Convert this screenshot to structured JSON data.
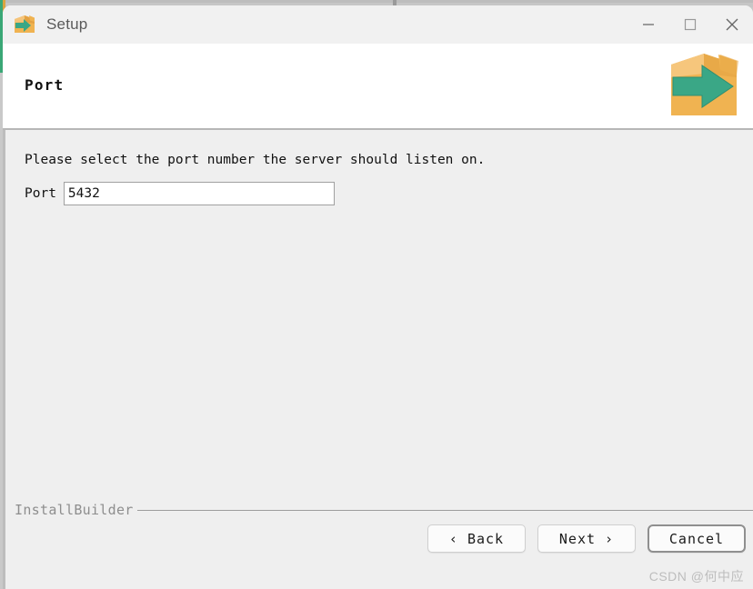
{
  "window": {
    "title": "Setup",
    "icon": "installer-box-arrow-icon",
    "controls": {
      "minimize": "minimize-icon",
      "maximize": "maximize-icon",
      "close": "close-icon"
    }
  },
  "header": {
    "title": "Port",
    "logo": "installer-box-arrow-logo"
  },
  "main": {
    "instruction": "Please select the port number the server should listen on.",
    "field": {
      "label": "Port",
      "value": "5432",
      "placeholder": ""
    }
  },
  "footer": {
    "brand": "InstallBuilder",
    "buttons": {
      "back": "‹ Back",
      "next": "Next ›",
      "cancel": "Cancel"
    }
  },
  "watermark": "CSDN @何中应",
  "colors": {
    "titlebar_bg": "#f1f1f1",
    "header_bg": "#ffffff",
    "body_bg": "#efefef",
    "box_orange": "#f0b351",
    "arrow_green": "#3aa786",
    "separator": "#b7b7b7"
  }
}
